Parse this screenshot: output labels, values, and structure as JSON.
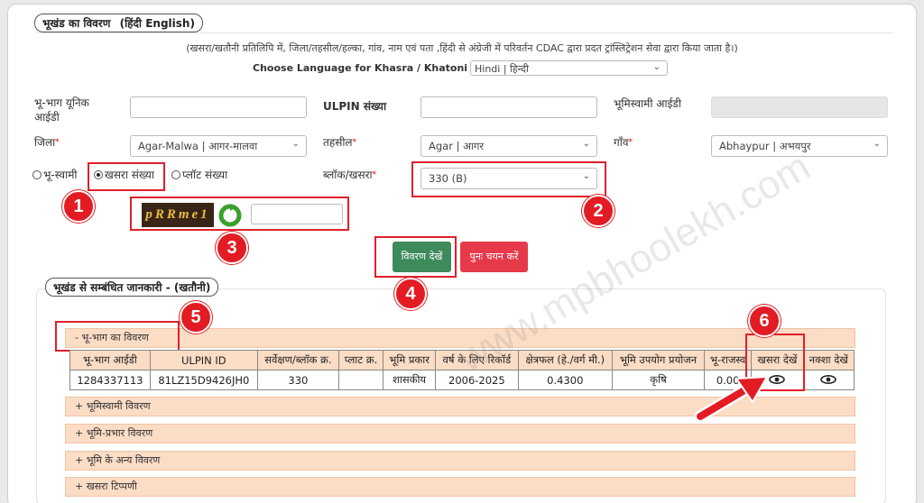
{
  "section1": {
    "legend": "भूखंड का विवरण",
    "lang_link": "(हिंदी  English)",
    "note": "(खसरा/खतौनी प्रतिलिपि में, जिला/तहसील/हल्का, गांव, नाम एवं पता ,हिंदी से अंग्रेजी में परिवर्तन CDAC द्वारा प्रदत ट्रांस्लिट्रेशन सेवा द्वारा किया जाता है।)",
    "lang_label": "Choose Language for Khasra / Khatoni Copy:",
    "lang_value": "Hindi | हिन्दी"
  },
  "form": {
    "bhu_unique_label": "भू-भाग यूनिक आईडी",
    "ulpin_label": "ULPIN संख्या",
    "owner_id_label": "भूमिस्वामी आईडी",
    "district_label": "जिला",
    "district_value": "Agar-Malwa | आगर-मालवा",
    "tehsil_label": "तहसील",
    "tehsil_value": "Agar | आगर",
    "village_label": "गाँव",
    "village_value": "Abhaypur | अभयपुर",
    "req": "*",
    "radio_owner": "भू-स्वामी",
    "radio_khasra": "खसरा संख्या",
    "radio_plot": "प्लॉट संख्या",
    "block_label": "ब्लॉक/खसरा",
    "block_value": "330 (B)",
    "captcha": "pRRme1",
    "view_button": "विवरण देखें",
    "reset_button": "पुनः चयन करें"
  },
  "section2": {
    "legend": "भूखंड से सम्बंधित जानकारी -   (खतौनी)",
    "acc_main": "- भू-भाग का विवरण",
    "columns": [
      "भू-भाग आईडी",
      "ULPIN ID",
      "सर्वेक्षण/ब्लॉक क्र.",
      "प्लाट क्र.",
      "भूमि प्रकार",
      "वर्ष के लिए रिकॉर्ड",
      "क्षेत्रफल (हे./वर्ग मी.)",
      "भूमि उपयोग प्रयोजन",
      "भू-राजस्व",
      "खसरा देखें",
      "नक्शा देखें"
    ],
    "row": [
      "1284337113",
      "81LZ15D9426JH0",
      "330",
      "",
      "शासकीय",
      "2006-2025",
      "0.4300",
      "कृषि",
      "0.00"
    ],
    "acc_owner": "+ भूमिस्वामी विवरण",
    "acc_charge": "+ भूमि-प्रभार विवरण",
    "acc_other": "+ भूमि के अन्य विवरण",
    "acc_note": "+ खसरा टिप्पणी"
  },
  "badges": [
    "1",
    "2",
    "3",
    "4",
    "5",
    "6"
  ],
  "watermark": "www.mpbhoolekh.com",
  "colors": {
    "accent_red": "#e31c23",
    "view_btn": "#3d8a5a",
    "reset_btn": "#e63a4a",
    "acc_bg": "#fbdcc5"
  }
}
